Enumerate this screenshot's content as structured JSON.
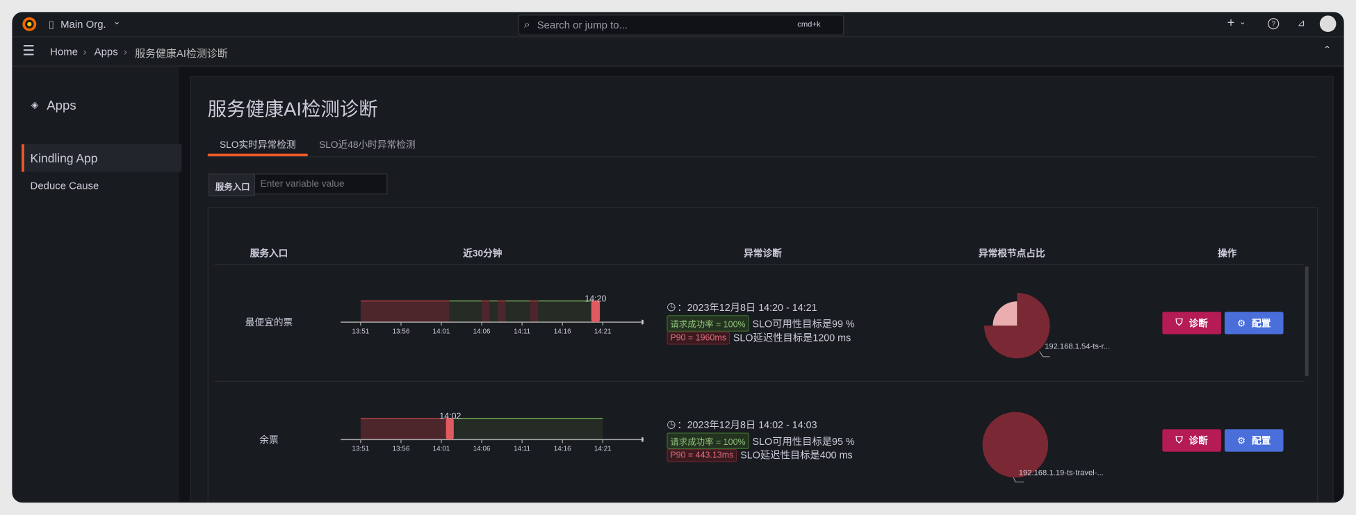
{
  "topbar": {
    "org": "Main Org.",
    "search_placeholder": "Search or jump to...",
    "shortcut": "cmd+k"
  },
  "breadcrumb": [
    "Home",
    "Apps",
    "服务健康AI检测诊断"
  ],
  "sidebar": {
    "title": "Apps",
    "items": [
      {
        "label": "Kindling App",
        "active": true
      },
      {
        "label": "Deduce Cause",
        "active": false
      }
    ]
  },
  "page": {
    "title": "服务健康AI检测诊断",
    "tabs": [
      {
        "label": "SLO实时异常检测",
        "active": true
      },
      {
        "label": "SLO近48小时异常检测",
        "active": false
      }
    ],
    "variable": {
      "label": "服务入口",
      "placeholder": "Enter variable value"
    }
  },
  "table": {
    "headers": [
      "服务入口",
      "近30分钟",
      "异常诊断",
      "异常根节点占比",
      "操作"
    ],
    "axis_ticks": [
      "13:51",
      "13:56",
      "14:01",
      "14:06",
      "14:11",
      "14:16",
      "14:21"
    ],
    "rows": [
      {
        "name": "最便宜的票",
        "marker": "14:20",
        "timeline": [
          {
            "from": "13:51",
            "to": "14:02",
            "status": "abnormal"
          },
          {
            "from": "14:02",
            "to": "14:06",
            "status": "normal"
          },
          {
            "from": "14:06",
            "to": "14:07",
            "status": "abnormal"
          },
          {
            "from": "14:07",
            "to": "14:08",
            "status": "normal"
          },
          {
            "from": "14:08",
            "to": "14:09",
            "status": "abnormal"
          },
          {
            "from": "14:09",
            "to": "14:12",
            "status": "normal"
          },
          {
            "from": "14:12",
            "to": "14:13",
            "status": "abnormal"
          },
          {
            "from": "14:13",
            "to": "14:20",
            "status": "normal"
          }
        ],
        "time_range": "：2023年12月8日 14:20 - 14:21",
        "success_tag": "请求成功率 = 100%",
        "availability": "SLO可用性目标是99 %",
        "p90_tag": "P90 = 1960ms",
        "latency": "SLO延迟性目标是1200 ms",
        "pie": {
          "slices": [
            {
              "label": "192.168.1.54-ts-r...",
              "value": 75,
              "color": "#7a2833"
            },
            {
              "label": "",
              "value": 25,
              "color": "#eaaeb0"
            }
          ]
        }
      },
      {
        "name": "余票",
        "marker": "14:02",
        "timeline": [
          {
            "from": "13:51",
            "to": "14:02",
            "status": "abnormal"
          },
          {
            "from": "14:02",
            "to": "14:21",
            "status": "normal"
          }
        ],
        "time_range": "：2023年12月8日 14:02 - 14:03",
        "success_tag": "请求成功率 = 100%",
        "availability": "SLO可用性目标是95 %",
        "p90_tag": "P90 = 443.13ms",
        "latency": "SLO延迟性目标是400 ms",
        "pie": {
          "slices": [
            {
              "label": "192.168.1.19-ts-travel-...",
              "value": 100,
              "color": "#7a2833"
            }
          ]
        }
      }
    ],
    "actions": {
      "diagnose": "诊断",
      "configure": "配置"
    }
  },
  "colors": {
    "diagnose": "#b51b55",
    "configure": "#4a6fdb",
    "abnormal": "#4d262c",
    "normal": "#252b25",
    "marker": "#e05a5f",
    "accent": "#f05a28"
  }
}
